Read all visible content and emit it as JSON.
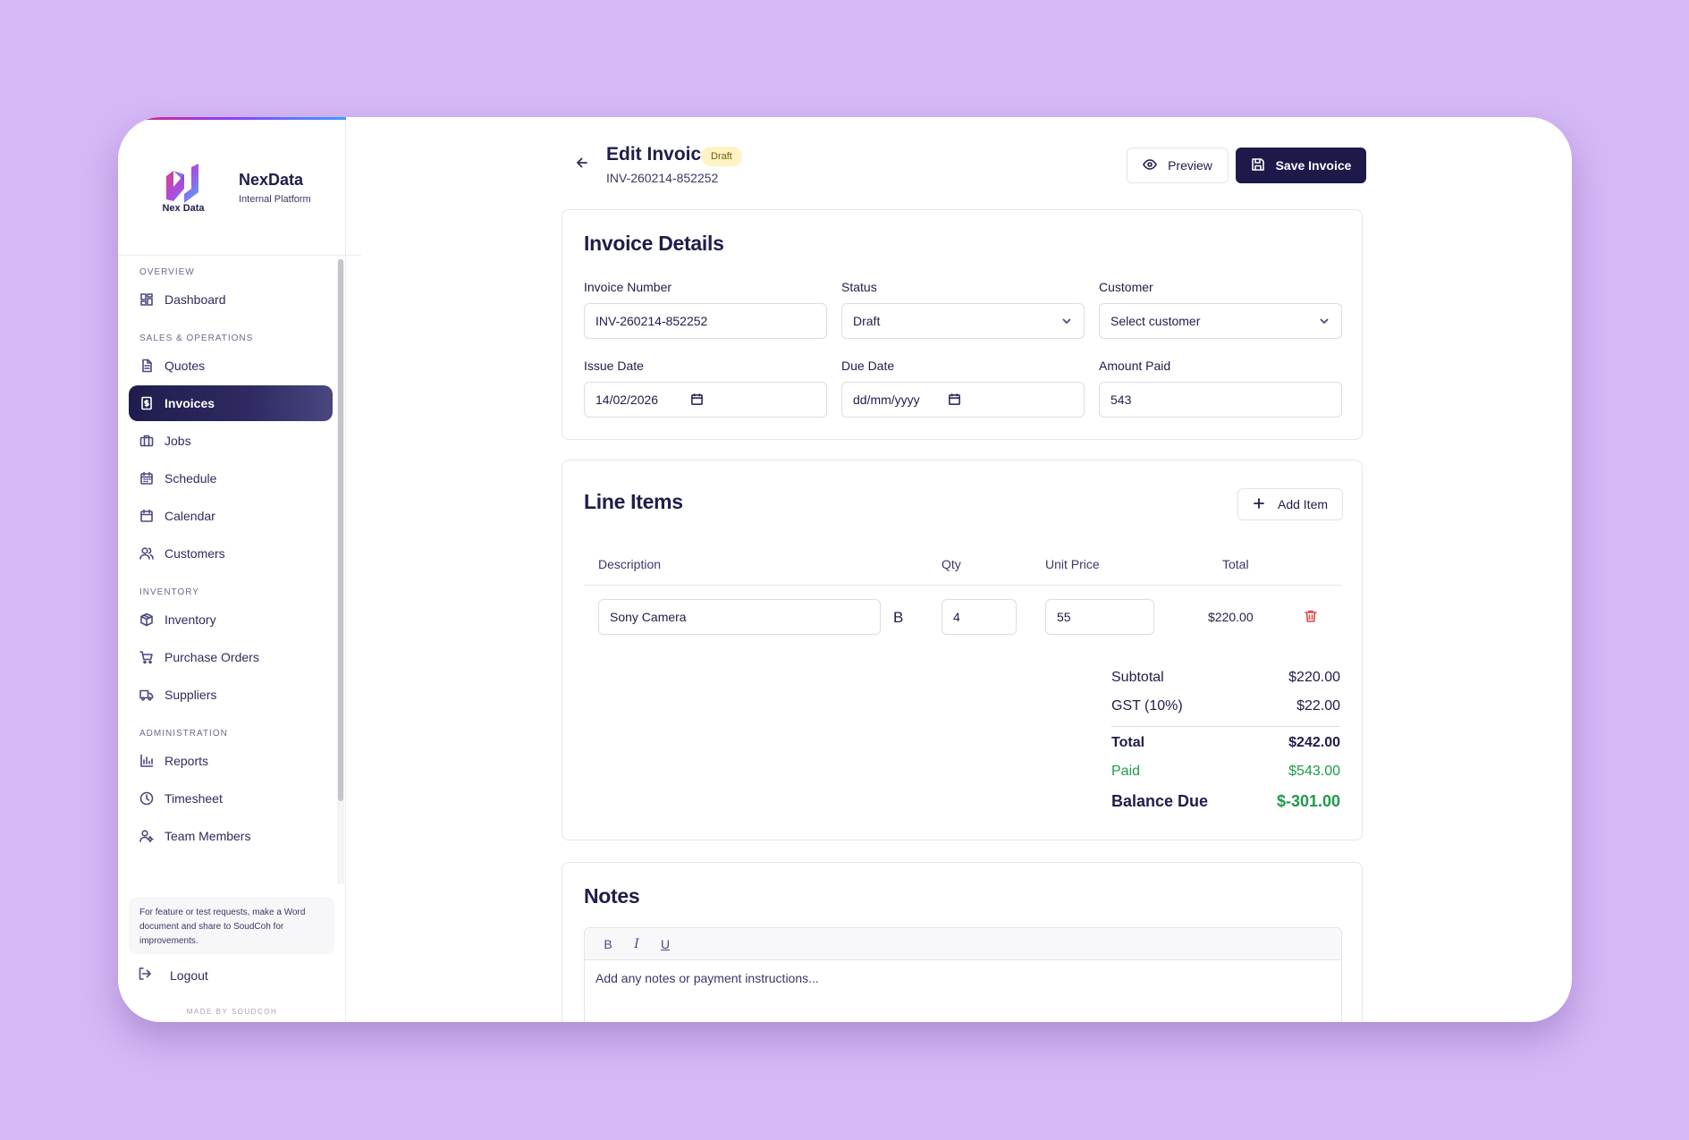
{
  "brand": {
    "logo_text": "Nex Data",
    "name": "NexData",
    "subtitle": "Internal Platform"
  },
  "nav": {
    "sections": [
      {
        "label": "OVERVIEW",
        "items": [
          {
            "label": "Dashboard",
            "icon": "grid-icon"
          }
        ]
      },
      {
        "label": "SALES & OPERATIONS",
        "items": [
          {
            "label": "Quotes",
            "icon": "document-icon"
          },
          {
            "label": "Invoices",
            "icon": "invoice-icon",
            "active": true
          },
          {
            "label": "Jobs",
            "icon": "briefcase-icon"
          },
          {
            "label": "Schedule",
            "icon": "calendar-icon"
          },
          {
            "label": "Calendar",
            "icon": "calendar-icon"
          },
          {
            "label": "Customers",
            "icon": "users-icon"
          }
        ]
      },
      {
        "label": "INVENTORY",
        "items": [
          {
            "label": "Inventory",
            "icon": "box-icon"
          },
          {
            "label": "Purchase Orders",
            "icon": "cart-icon"
          },
          {
            "label": "Suppliers",
            "icon": "truck-icon"
          }
        ]
      },
      {
        "label": "ADMINISTRATION",
        "items": [
          {
            "label": "Reports",
            "icon": "bar-chart-icon"
          },
          {
            "label": "Timesheet",
            "icon": "clock-icon"
          },
          {
            "label": "Team Members",
            "icon": "user-gear-icon"
          }
        ]
      }
    ],
    "help_text": "For feature or test requests, make a Word document and share to SoudCoh for improvements.",
    "logout_label": "Logout",
    "made_by": "MADE BY SOUDCOH"
  },
  "header": {
    "title": "Edit Invoice",
    "status_badge": "Draft",
    "invoice_number": "INV-260214-852252",
    "preview_label": "Preview",
    "save_label": "Save Invoice"
  },
  "details": {
    "title": "Invoice Details",
    "invoice_number_label": "Invoice Number",
    "invoice_number_value": "INV-260214-852252",
    "status_label": "Status",
    "status_value": "Draft",
    "customer_label": "Customer",
    "customer_value": "Select customer",
    "issue_date_label": "Issue Date",
    "issue_date_value": "14/02/2026",
    "due_date_label": "Due Date",
    "due_date_value": "dd/mm/yyyy",
    "amount_paid_label": "Amount Paid",
    "amount_paid_value": "543"
  },
  "line_items": {
    "title": "Line Items",
    "add_item_label": "Add Item",
    "columns": {
      "description": "Description",
      "qty": "Qty",
      "unit_price": "Unit Price",
      "total": "Total"
    },
    "rows": [
      {
        "description": "Sony Camera",
        "format": "B",
        "qty": "4",
        "unit_price": "55",
        "total": "$220.00"
      }
    ],
    "summary": {
      "subtotal_label": "Subtotal",
      "subtotal_value": "$220.00",
      "gst_label": "GST (10%)",
      "gst_value": "$22.00",
      "total_label": "Total",
      "total_value": "$242.00",
      "paid_label": "Paid",
      "paid_value": "$543.00",
      "balance_label": "Balance Due",
      "balance_value": "$-301.00"
    }
  },
  "notes": {
    "title": "Notes",
    "toolbar": {
      "bold": "B",
      "italic": "I",
      "underline": "U"
    },
    "placeholder": "Add any notes or payment instructions..."
  },
  "colors": {
    "background": "#d5b8f6",
    "primary": "#1d1a4a",
    "badge_bg": "#fdf3c4",
    "success": "#1f9a4a",
    "danger": "#e04848"
  }
}
